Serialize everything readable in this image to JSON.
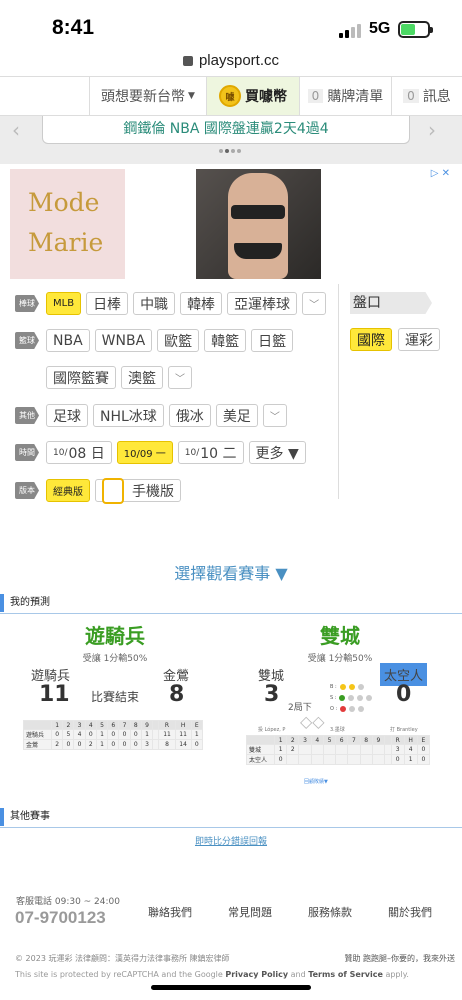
{
  "status_bar": {
    "time": "8:41",
    "network": "5G"
  },
  "url_bar": {
    "domain": "playsport.cc"
  },
  "top_nav": {
    "currency_label": "頭想要新台幣",
    "buy_coin_label": "買噱幣",
    "coin_icon_text": "噱",
    "cart_count": "0",
    "cart_label": "購牌清單",
    "msg_count": "0",
    "msg_label": "訊息"
  },
  "marquee": {
    "text": "鋼鐵倫 NBA 國際盤連贏2天4過4"
  },
  "ad": {
    "brand_line1": "Mode",
    "brand_line2": "Marie"
  },
  "filters": {
    "baseball": {
      "label": "棒球",
      "items": [
        "MLB",
        "日棒",
        "中職",
        "韓棒",
        "亞運棒球"
      ]
    },
    "basketball": {
      "label": "籃球",
      "items": [
        "NBA",
        "WNBA",
        "歐籃",
        "韓籃",
        "日籃"
      ],
      "items2": [
        "國際籃賽",
        "澳籃"
      ]
    },
    "other": {
      "label": "其他",
      "items": [
        "足球",
        "NHL冰球",
        "俄冰",
        "美足"
      ]
    },
    "time": {
      "label": "時間",
      "d1_month": "10/",
      "d1_day": "08 日",
      "d2": "10/09 一",
      "d3_month": "10/",
      "d3_day": "10 二",
      "more": "更多 ▼"
    },
    "version": {
      "label": "版本",
      "classic": "經典版",
      "mobile": "手機版"
    },
    "odds": {
      "label": "盤口",
      "international": "國際",
      "lottery": "運彩"
    }
  },
  "select_game": "選擇觀看賽事 ▼",
  "my_prediction": "我的預測",
  "games": [
    {
      "title": "遊騎兵",
      "rule": "受讓 1分輸50%",
      "away": "遊騎兵",
      "home": "金鶯",
      "away_score": "11",
      "home_score": "8",
      "status": "比賽結束",
      "box_header": [
        "",
        "1",
        "2",
        "3",
        "4",
        "5",
        "6",
        "7",
        "8",
        "9",
        "",
        "R",
        "H",
        "E"
      ],
      "box_rows": [
        [
          "遊騎兵",
          "0",
          "5",
          "4",
          "0",
          "1",
          "0",
          "0",
          "0",
          "1",
          "",
          "11",
          "11",
          "1"
        ],
        [
          "金鶯",
          "2",
          "0",
          "0",
          "2",
          "1",
          "0",
          "0",
          "0",
          "3",
          "",
          "8",
          "14",
          "0"
        ]
      ]
    },
    {
      "title": "雙城",
      "rule": "受讓 1分輸50%",
      "away": "雙城",
      "home": "太空人",
      "away_score": "3",
      "home_score": "0",
      "inning": "2局下",
      "bso": [
        "B :",
        "S :",
        "O :"
      ],
      "pitcher_l": "投 López, P",
      "batter_mid": "3.墨球",
      "batter_r": "打 Brantley",
      "box_header": [
        "",
        "1",
        "2",
        "3",
        "4",
        "5",
        "6",
        "7",
        "8",
        "9",
        "",
        "R",
        "H",
        "E"
      ],
      "box_rows": [
        [
          "雙城",
          "1",
          "2",
          "",
          "",
          "",
          "",
          "",
          "",
          "",
          "",
          "3",
          "4",
          "0"
        ],
        [
          "太空人",
          "0",
          "",
          "",
          "",
          "",
          "",
          "",
          "",
          "",
          "",
          "0",
          "1",
          "0"
        ]
      ],
      "replay": "回顧敗績▼"
    }
  ],
  "other_games": "其他賽事",
  "report_link": "即時比分錯誤回報",
  "footer": {
    "hotline_label": "客服電話 09:30 ~ 24:00",
    "hotline": "07-9700123",
    "links": [
      "聯絡我們",
      "常見問題",
      "服務條款",
      "關於我們"
    ],
    "copyright": "© 2023 玩運彩 法律顧問：漢英得力法律事務所 陳鎮宏律師",
    "sponsor": "贊助 跑跑腿–你要的，我來外送",
    "captcha_pre": "This site is protected by reCAPTCHA and the Google ",
    "privacy": "Privacy Policy",
    "and": " and ",
    "terms": "Terms of Service",
    "apply": " apply."
  },
  "colors": {
    "accent_green": "#3a9d23",
    "link_blue": "#4a90c2",
    "highlight_yellow": "#ffe83a"
  }
}
